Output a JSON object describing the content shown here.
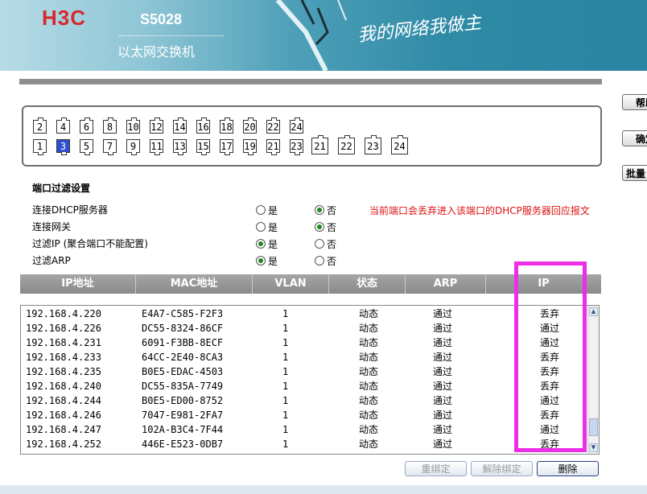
{
  "header": {
    "brand": "H3C",
    "model": "S5028",
    "subtitle": "以太网交换机",
    "slogan": "我的网络我做主"
  },
  "side_buttons": [
    "帮助",
    "确定",
    "批量"
  ],
  "ports": {
    "top_row": [
      "2",
      "4",
      "6",
      "8",
      "10",
      "12",
      "14",
      "16",
      "18",
      "20",
      "22",
      "24"
    ],
    "bottom_row": [
      "1",
      "3",
      "5",
      "7",
      "9",
      "11",
      "13",
      "15",
      "17",
      "19",
      "21",
      "23"
    ],
    "extra": [
      "21",
      "22",
      "23",
      "24"
    ],
    "selected": "3"
  },
  "settings": {
    "title": "端口过滤设置",
    "yes_label": "是",
    "no_label": "否",
    "rows": [
      {
        "label": "连接DHCP服务器",
        "value": "否"
      },
      {
        "label": "连接网关",
        "value": "否"
      },
      {
        "label": "过滤IP (聚合端口不能配置)",
        "value": "是"
      },
      {
        "label": "过滤ARP",
        "value": "是"
      }
    ],
    "note": "当前端口会丢弃进入该端口的DHCP服务器回应报文"
  },
  "table": {
    "headers": [
      "IP地址",
      "MAC地址",
      "VLAN",
      "状态",
      "ARP",
      "IP"
    ],
    "rows": [
      [
        "192.168.4.220",
        "E4A7-C585-F2F3",
        "1",
        "动态",
        "通过",
        "丢弃"
      ],
      [
        "192.168.4.226",
        "DC55-8324-86CF",
        "1",
        "动态",
        "通过",
        "通过"
      ],
      [
        "192.168.4.231",
        "6091-F3BB-8ECF",
        "1",
        "动态",
        "通过",
        "通过"
      ],
      [
        "192.168.4.233",
        "64CC-2E40-8CA3",
        "1",
        "动态",
        "通过",
        "丢弃"
      ],
      [
        "192.168.4.235",
        "B0E5-EDAC-4503",
        "1",
        "动态",
        "通过",
        "丢弃"
      ],
      [
        "192.168.4.240",
        "DC55-835A-7749",
        "1",
        "动态",
        "通过",
        "丢弃"
      ],
      [
        "192.168.4.244",
        "B0E5-ED00-8752",
        "1",
        "动态",
        "通过",
        "通过"
      ],
      [
        "192.168.4.246",
        "7047-E981-2FA7",
        "1",
        "动态",
        "通过",
        "丢弃"
      ],
      [
        "192.168.4.247",
        "102A-B3C4-7F44",
        "1",
        "动态",
        "通过",
        "通过"
      ],
      [
        "192.168.4.252",
        "446E-E523-0DB7",
        "1",
        "动态",
        "通过",
        "丢弃"
      ]
    ]
  },
  "actions": {
    "rebind": "重绑定",
    "unbind": "解除绑定",
    "delete": "删除"
  },
  "colors": {
    "highlight": "#ee2ee6",
    "note": "#dd1111",
    "selected_port": "#2d4fcf"
  }
}
